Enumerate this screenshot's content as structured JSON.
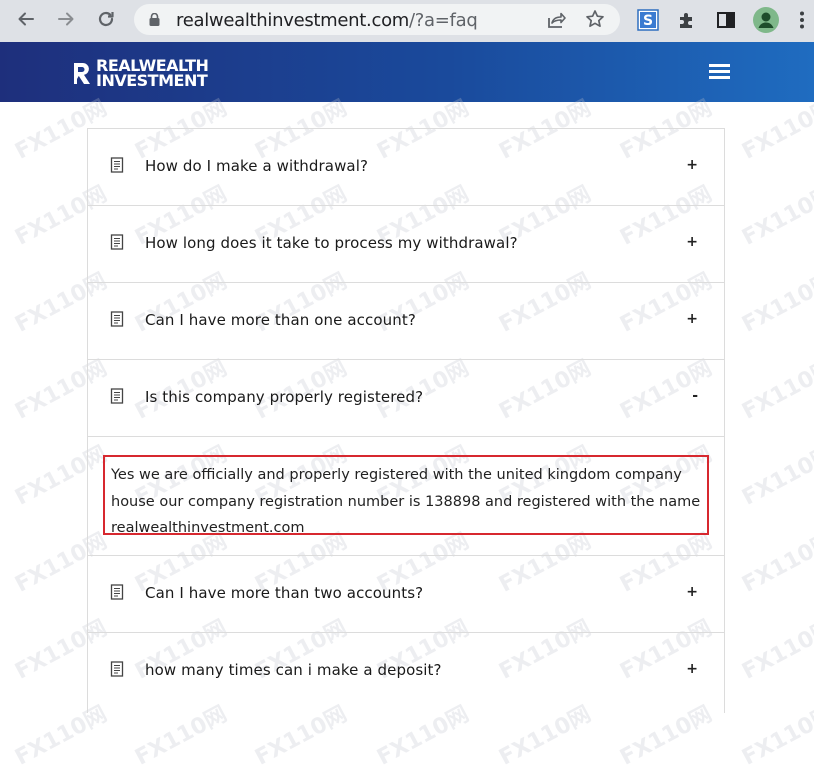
{
  "browser": {
    "url_host": "realwealthinvestment.com",
    "url_path": "/?a=faq",
    "icons": {
      "back": "arrow-left-icon",
      "forward": "arrow-right-icon",
      "reload": "reload-icon",
      "lock": "lock-icon",
      "share": "share-icon",
      "bookmark": "star-icon",
      "extension_s": "extension-s-icon",
      "extensions": "puzzle-icon",
      "sidepanel": "side-panel-icon",
      "profile": "profile-icon",
      "menu": "kebab-menu-icon"
    }
  },
  "site": {
    "logo_line1": "REALWEALTH",
    "logo_line2": "INVESTMENT",
    "menu_icon": "hamburger-icon",
    "header_colors": [
      "#1e2f7c",
      "#1f6cc0"
    ]
  },
  "watermark": "FX110网",
  "faq": {
    "items": [
      {
        "question": "How do I make a withdrawal?",
        "toggle": "+"
      },
      {
        "question": "How long does it take to process my withdrawal?",
        "toggle": "+"
      },
      {
        "question": "Can I have more than one account?",
        "toggle": "+"
      },
      {
        "question": "Is this company properly registered?",
        "toggle": "-",
        "answer": "Yes we are officially and properly registered with the united kingdom company house our company registration number is 138898 and registered with the name realwealthinvestment.com"
      },
      {
        "question": "Can I have more than two accounts?",
        "toggle": "+"
      },
      {
        "question": "how many times can i make a deposit?",
        "toggle": "+"
      }
    ],
    "highlight_color": "#d7282f"
  }
}
